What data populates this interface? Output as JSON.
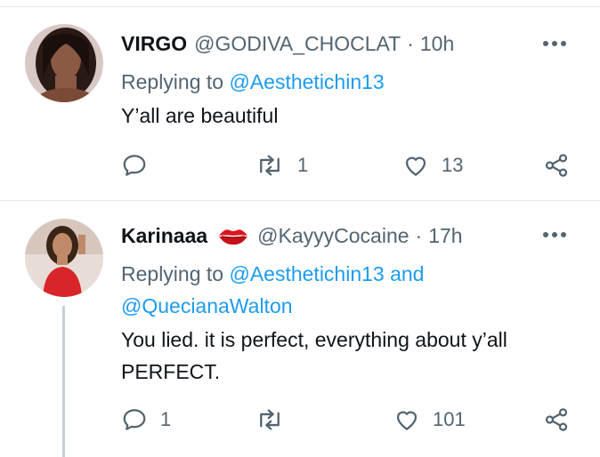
{
  "tweets": [
    {
      "display_name": "VIRGO",
      "handle": "@GODIVA_CHOCLAT",
      "separator": "·",
      "time": "10h",
      "replying_prefix": "Replying to ",
      "replying_mentions": "@Aesthetichin13",
      "text_lines": [
        "Y’all are beautiful"
      ],
      "reply_count": "",
      "retweet_count": "1",
      "like_count": "13",
      "icons": [
        "reply-icon",
        "retweet-icon",
        "like-icon",
        "share-icon",
        "more-icon"
      ]
    },
    {
      "display_name": "Karinaaa",
      "emoji": "lips-emoji",
      "handle": "@KayyyCocaine",
      "separator": "·",
      "time": "17h",
      "replying_prefix": "Replying to ",
      "replying_line1_mention": "@Aesthetichin13 and",
      "replying_line2_mention": "@QuecianaWalton",
      "text_lines": [
        "You lied. it is perfect, everything about y’all",
        "PERFECT."
      ],
      "reply_count": "1",
      "retweet_count": "",
      "like_count": "101",
      "icons": [
        "reply-icon",
        "retweet-icon",
        "like-icon",
        "share-icon",
        "more-icon"
      ]
    }
  ],
  "colors": {
    "text": "#0f1419",
    "muted": "#536471",
    "link": "#1d9bf0",
    "divider": "#e1e8ed",
    "thread_line": "#c4cfd6"
  }
}
